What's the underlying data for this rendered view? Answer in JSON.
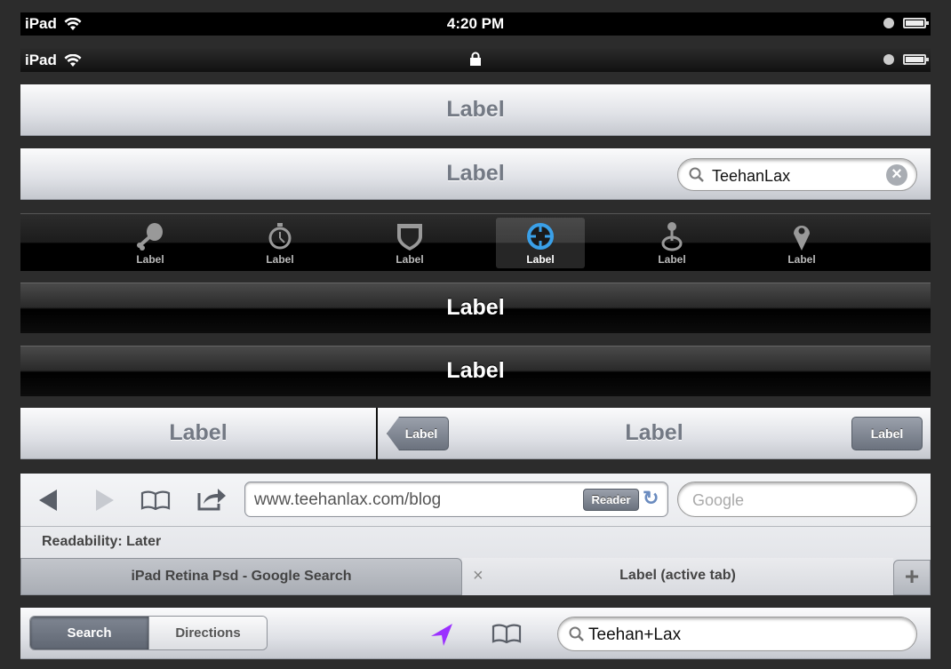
{
  "status_bar_1": {
    "device": "iPad",
    "time": "4:20 PM",
    "wifi_icon": "wifi-icon",
    "battery_icon": "battery-icon"
  },
  "status_bar_2": {
    "device": "iPad",
    "center_icon": "lock-icon"
  },
  "nav_bar_1": {
    "title": "Label"
  },
  "nav_bar_2": {
    "title": "Label",
    "search_value": "TeehanLax"
  },
  "tab_bar": {
    "items": [
      {
        "label": "Label",
        "icon": "drumstick-icon"
      },
      {
        "label": "Label",
        "icon": "stopwatch-icon"
      },
      {
        "label": "Label",
        "icon": "shield-icon"
      },
      {
        "label": "Label",
        "icon": "crosshair-icon",
        "selected": true
      },
      {
        "label": "Label",
        "icon": "joystick-icon"
      },
      {
        "label": "Label",
        "icon": "map-pin-icon"
      }
    ],
    "selected_color": "#3aa0e8"
  },
  "dark_bar_1": {
    "title": "Label"
  },
  "dark_bar_2": {
    "title": "Label"
  },
  "split_view": {
    "master_title": "Label",
    "detail_title": "Label",
    "back_label": "Label",
    "right_label": "Label"
  },
  "safari": {
    "url": "www.teehanlax.com/blog",
    "reader_label": "Reader",
    "search_placeholder": "Google",
    "bookmark": "Readability: Later",
    "tabs": [
      {
        "label": "iPad Retina Psd - Google Search",
        "active": false
      },
      {
        "label": "Label (active tab)",
        "active": true
      }
    ],
    "close_tab": "×",
    "new_tab": "+"
  },
  "maps_bar": {
    "segments": [
      {
        "label": "Search",
        "selected": true
      },
      {
        "label": "Directions",
        "selected": false
      }
    ],
    "search_value": "Teehan+Lax",
    "location_color": "#9b30ff"
  }
}
